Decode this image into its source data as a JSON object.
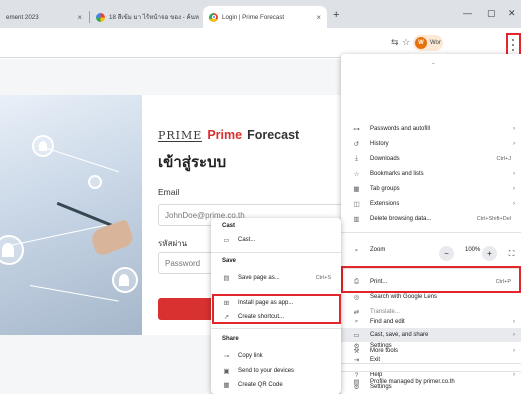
{
  "tabs": [
    {
      "title": "ement 2023",
      "active": false
    },
    {
      "title": "18 สีเข้ม มา ไร้หน้าจอ ของ - ค้นห",
      "active": false
    },
    {
      "title": "Login | Prime Forecast",
      "active": true
    }
  ],
  "toolbar": {
    "profile_initial": "W",
    "profile_name": "Wor"
  },
  "page": {
    "logo_text": "PRIME",
    "brand_prime": "Prime",
    "brand_forecast": "Forecast",
    "login_title": "เข้าสู่ระบบ",
    "email_label": "Email",
    "email_placeholder": "JohnDoe@prime.co.th",
    "password_label": "รหัสผ่าน",
    "password_placeholder": "Password"
  },
  "main_menu": {
    "tip": "–",
    "items": [
      {
        "icon": "key-icon",
        "glyph": "⊶",
        "label": "Passwords and autofill",
        "arrow": true
      },
      {
        "icon": "history-icon",
        "glyph": "↺",
        "label": "History",
        "arrow": true
      },
      {
        "icon": "download-icon",
        "glyph": "⤓",
        "label": "Downloads",
        "shortcut": "Ctrl+J"
      },
      {
        "icon": "star-icon",
        "glyph": "☆",
        "label": "Bookmarks and lists",
        "arrow": true
      },
      {
        "icon": "tab-groups-icon",
        "glyph": "▦",
        "label": "Tab groups",
        "arrow": true
      },
      {
        "icon": "extensions-icon",
        "glyph": "◫",
        "label": "Extensions",
        "arrow": true
      },
      {
        "icon": "trash-icon",
        "glyph": "▥",
        "label": "Delete browsing data...",
        "shortcut": "Ctrl+Shift+Del"
      }
    ],
    "zoom": {
      "label": "Zoom",
      "value": "100%",
      "minus": "−",
      "plus": "+",
      "fullscreen": "⛶",
      "glyph": "⌕"
    },
    "items2": [
      {
        "icon": "print-icon",
        "glyph": "⎙",
        "label": "Print...",
        "shortcut": "Ctrl+P"
      },
      {
        "icon": "lens-icon",
        "glyph": "◎",
        "label": "Search with Google Lens"
      },
      {
        "icon": "translate-icon",
        "glyph": "⇄",
        "label": "Translate..."
      },
      {
        "icon": "find-icon",
        "glyph": "⌕",
        "label": "Find and edit",
        "arrow": true
      },
      {
        "icon": "cast-icon",
        "glyph": "▭",
        "label": "Cast, save, and share",
        "arrow": true,
        "highlight": true
      },
      {
        "icon": "more-tools-icon",
        "glyph": "⚒",
        "label": "More tools",
        "arrow": true
      }
    ],
    "items3": [
      {
        "icon": "help-icon",
        "glyph": "?",
        "label": "Help",
        "arrow": true
      },
      {
        "icon": "settings-icon",
        "glyph": "⚙",
        "label": "Settings"
      },
      {
        "icon": "exit-icon",
        "glyph": "⇥",
        "label": "Exit"
      }
    ],
    "managed": "Profile managed by primer.co.th"
  },
  "sub_menu": {
    "cast_heading": "Cast",
    "cast_item": {
      "icon": "cast-icon",
      "glyph": "▭",
      "label": "Cast..."
    },
    "save_heading": "Save",
    "save_items": [
      {
        "icon": "save-page-icon",
        "glyph": "▤",
        "label": "Save page as...",
        "shortcut": "Ctrl+S"
      },
      {
        "icon": "install-icon",
        "glyph": "⊞",
        "label": "Install page as app..."
      },
      {
        "icon": "shortcut-icon",
        "glyph": "↗",
        "label": "Create shortcut..."
      }
    ],
    "share_heading": "Share",
    "share_items": [
      {
        "icon": "link-icon",
        "glyph": "⊸",
        "label": "Copy link"
      },
      {
        "icon": "devices-icon",
        "glyph": "▣",
        "label": "Send to your devices"
      },
      {
        "icon": "qr-code-icon",
        "glyph": "▦",
        "label": "Create QR Code"
      }
    ]
  }
}
